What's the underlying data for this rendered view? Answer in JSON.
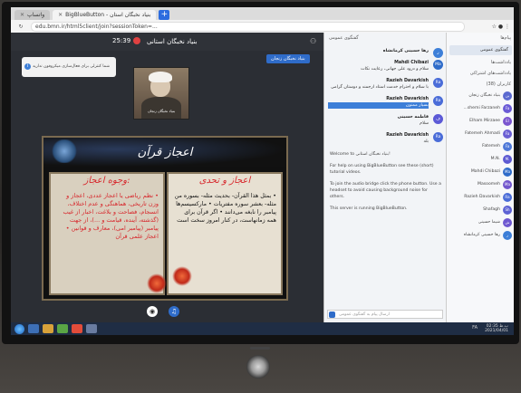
{
  "browser": {
    "tabs": [
      {
        "label": "واتساپ"
      },
      {
        "label": "BigBlueButton - بنیاد نخبگان استان"
      }
    ],
    "url": "edu.bmn.ir/html5client/join?sessionToken=...",
    "new_tab": "+"
  },
  "presentation": {
    "timer": "25:39",
    "meeting_name": "بنیاد نخبگان استانی",
    "notice": "شما کنترلی برای فعال‌سازی میکروفون ندارید",
    "presenter_badge": "بنیاد نخبگان زنجان",
    "webcam_label": "بنیاد نخبگان زنجان",
    "slide": {
      "title": "اعجاز قرآن",
      "left_head": "وجوه اعجاز:",
      "left_body": "• نظم ریاضی یا اعجاز عددی، اعجاز و وزن تاریخی، هماهنگی و عدم اختلاف، انسجام، فصاحت و بلاغت، اخبار از غیب (گذشته، آینده، قیامت و ...)، از جهت پیامبر (پیامبر امی)، معارف و قوانین • اعجاز علمی قرآن",
      "right_head": "اعجاز و تحدی",
      "right_body": "• بمثل هذا القرآن- بحدیث مثله- بسوره من مثله- بعشر سوره مفتریات • مارکسیسم‌ها پیامبر را نابغه می‌دانند • اگر قرآن برای همه زمانهاست، در کنار امروز سخت است"
    }
  },
  "chat": {
    "header": "گفتگوی عمومی",
    "messages": [
      {
        "name": "رها حسینی کرمانشاه",
        "text": "",
        "avatar": "ر",
        "color": "#3d7fd8"
      },
      {
        "name": "Mahdi Chibazi",
        "text": "سلام و درود علی جهانی، رعایت نکات",
        "avatar": "Ma",
        "color": "#2f6cc9"
      },
      {
        "name": "Razieh Davarkish",
        "text": "با سلام و احترام خدمت استاد ارجمند و دوستان گرامی",
        "avatar": "Ra",
        "color": "#4a6cd8"
      },
      {
        "name": "Razieh Davarkish",
        "text": "بسیار ممنون",
        "avatar": "Ra",
        "color": "#4a6cd8",
        "highlight": true
      },
      {
        "name": "فاطمه حسینی",
        "text": "سلام",
        "avatar": "ف",
        "color": "#5b59d6"
      },
      {
        "name": "Razieh Davarkish",
        "text": "بله",
        "avatar": "Ra",
        "color": "#4a6cd8"
      }
    ],
    "welcome": [
      "Welcome to بنیاد نخبگان استانی!",
      "For help on using BigBlueButton see these (short) tutorial videos.",
      "To join the audio bridge click the phone button. Use a headset to avoid causing background noise for others.",
      "This server is running BigBlueButton."
    ],
    "input_placeholder": "ارسال پیام به گفتگوی عمومی"
  },
  "users": {
    "messages_section": "پیام‌ها",
    "chat_item": "گفتگوی عمومی",
    "notes_section": "یادداشت‌ها",
    "notes_item": "یادداشت‌های اشتراکی",
    "users_section": "کاربران (38)",
    "list": [
      {
        "name": "بنیاد نخبگان زنجان",
        "avatar": "بن",
        "color": "#5b6ad0"
      },
      {
        "name": "...shemi Farzaneh",
        "avatar": "Fa",
        "color": "#6b5bd6"
      },
      {
        "name": "Elham Mirzaee",
        "avatar": "El",
        "color": "#7a55cf"
      },
      {
        "name": "Fatemeh Ahmadi",
        "avatar": "Fa",
        "color": "#6c60d4"
      },
      {
        "name": "Fatemeh",
        "avatar": "Fa",
        "color": "#4f79d8"
      },
      {
        "name": "M.N.",
        "avatar": "M.",
        "color": "#5d5ad2"
      },
      {
        "name": "Mahdi Chibazi",
        "avatar": "Ma",
        "color": "#2f6cc9"
      },
      {
        "name": "Masoomeh",
        "avatar": "Ma",
        "color": "#7256cd"
      },
      {
        "name": "Razieh Davarkish",
        "avatar": "Ra",
        "color": "#4a6cd8"
      },
      {
        "name": "Shafagh",
        "avatar": "Sh",
        "color": "#5d62d4"
      },
      {
        "name": "شیما حسینی",
        "avatar": "ش",
        "color": "#6e58d0"
      },
      {
        "name": "رها حسینی کرمانشاه",
        "avatar": "ر",
        "color": "#3d7fd8"
      }
    ]
  },
  "taskbar": {
    "clock": "02:35 ب.ظ",
    "date": "2021/04/01",
    "tray": "FA"
  }
}
